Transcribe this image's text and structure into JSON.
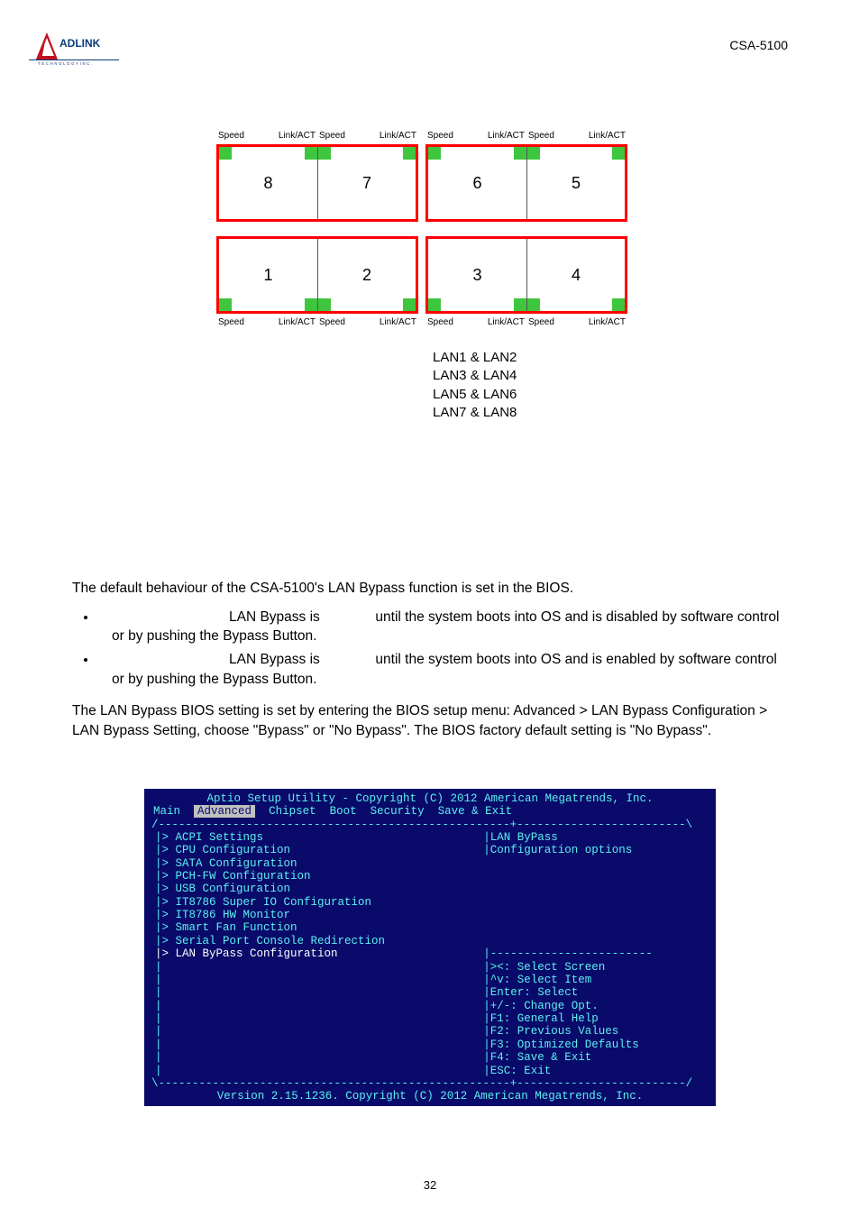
{
  "header": {
    "model": "CSA-5100"
  },
  "diagram": {
    "label_speed": "Speed",
    "label_linkact": "Link/ACT",
    "ports_top": [
      "8",
      "7",
      "6",
      "5"
    ],
    "ports_bottom": [
      "1",
      "2",
      "3",
      "4"
    ],
    "pairs": [
      "LAN1 & LAN2",
      "LAN3 & LAN4",
      "LAN5 & LAN6",
      "LAN7 & LAN8"
    ]
  },
  "body": {
    "intro": "The default behaviour of the CSA-5100's LAN Bypass function is set in the BIOS.",
    "bullet1": {
      "a": "LAN Bypass is ",
      "b": " until the system boots into OS and is disabled by software control or by pushing the Bypass Button."
    },
    "bullet2": {
      "a": "LAN Bypass is ",
      "b": " until the system boots into OS and is enabled by software control or by pushing the Bypass Button."
    },
    "bios_path": "The LAN Bypass BIOS setting is set by entering the BIOS setup menu: Advanced > LAN Bypass Configuration > LAN Bypass Setting, choose \"Bypass\" or \"No Bypass\". The BIOS factory default setting is \"No Bypass\"."
  },
  "bios": {
    "title": "Aptio Setup Utility - Copyright (C) 2012 American Megatrends, Inc.",
    "menus": [
      "Main",
      "Advanced",
      "Chipset",
      "Boot",
      "Security",
      "Save & Exit"
    ],
    "items": [
      "ACPI Settings",
      "CPU Configuration",
      "SATA Configuration",
      "PCH-FW Configuration",
      "USB Configuration",
      "IT8786 Super IO Configuration",
      "IT8786 HW Monitor",
      "Smart Fan Function",
      "Serial Port Console Redirection",
      "LAN ByPass Configuration"
    ],
    "help": [
      "|LAN ByPass",
      "|Configuration options"
    ],
    "keys": [
      "|><: Select Screen",
      "|^v: Select Item",
      "|Enter: Select",
      "|+/-: Change Opt.",
      "|F1: General Help",
      "|F2: Previous Values",
      "|F3: Optimized Defaults",
      "|F4: Save & Exit",
      "|ESC: Exit"
    ],
    "footer": "Version 2.15.1236. Copyright (C) 2012 American Megatrends, Inc."
  },
  "footer": {
    "page": "32"
  }
}
